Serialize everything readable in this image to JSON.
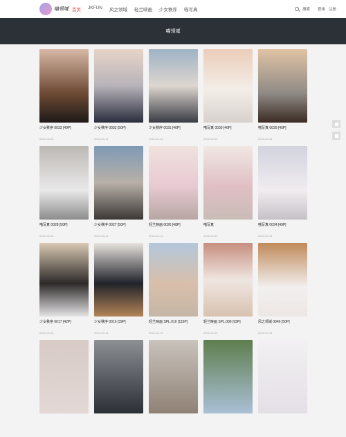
{
  "header": {
    "logo_text": "喵领域",
    "nav": [
      "首页",
      "JKFUN",
      "风之领域",
      "轻兰映画",
      "少女秩序",
      "喵写真"
    ],
    "search_label": "搜索",
    "login_label": "登录",
    "register_label": "注册"
  },
  "banner_title": "喵领域",
  "posts": [
    {
      "title": "少女秩序 0033 [49P]",
      "date": "2022-03-14"
    },
    {
      "title": "少女秩序 0032 [50P]",
      "date": "2022-03-14"
    },
    {
      "title": "少女秩序 0031 [46P]",
      "date": "2022-03-14"
    },
    {
      "title": "喵写真 0030 [46P]",
      "date": "2022-03-14"
    },
    {
      "title": "喵写真 0029 [45P]",
      "date": "2022-03-14"
    },
    {
      "title": "喵写真 0028 [50P]",
      "date": "2022-03-14"
    },
    {
      "title": "少女秩序 0027 [50P]",
      "date": "2022-03-14"
    },
    {
      "title": "轻兰映画 0026 [48P]",
      "date": "2022-03-14"
    },
    {
      "title": "喵写真",
      "date": "2022-03-14"
    },
    {
      "title": "喵写真 0024 [49P]",
      "date": "2022-03-14"
    },
    {
      "title": "少女秩序 0017 [42P]",
      "date": "2022-03-14"
    },
    {
      "title": "少女秩序 0016 [39P]",
      "date": "2022-03-14"
    },
    {
      "title": "轻兰映画 SPL.010 [115P]",
      "date": "2022-03-14"
    },
    {
      "title": "轻兰映画 SPL.009 [93P]",
      "date": "2022-03-14"
    },
    {
      "title": "风之领域 0046 [50P]",
      "date": "2022-03-14"
    },
    {
      "title": "",
      "date": ""
    },
    {
      "title": "",
      "date": ""
    },
    {
      "title": "",
      "date": ""
    },
    {
      "title": "",
      "date": ""
    },
    {
      "title": "",
      "date": ""
    }
  ]
}
